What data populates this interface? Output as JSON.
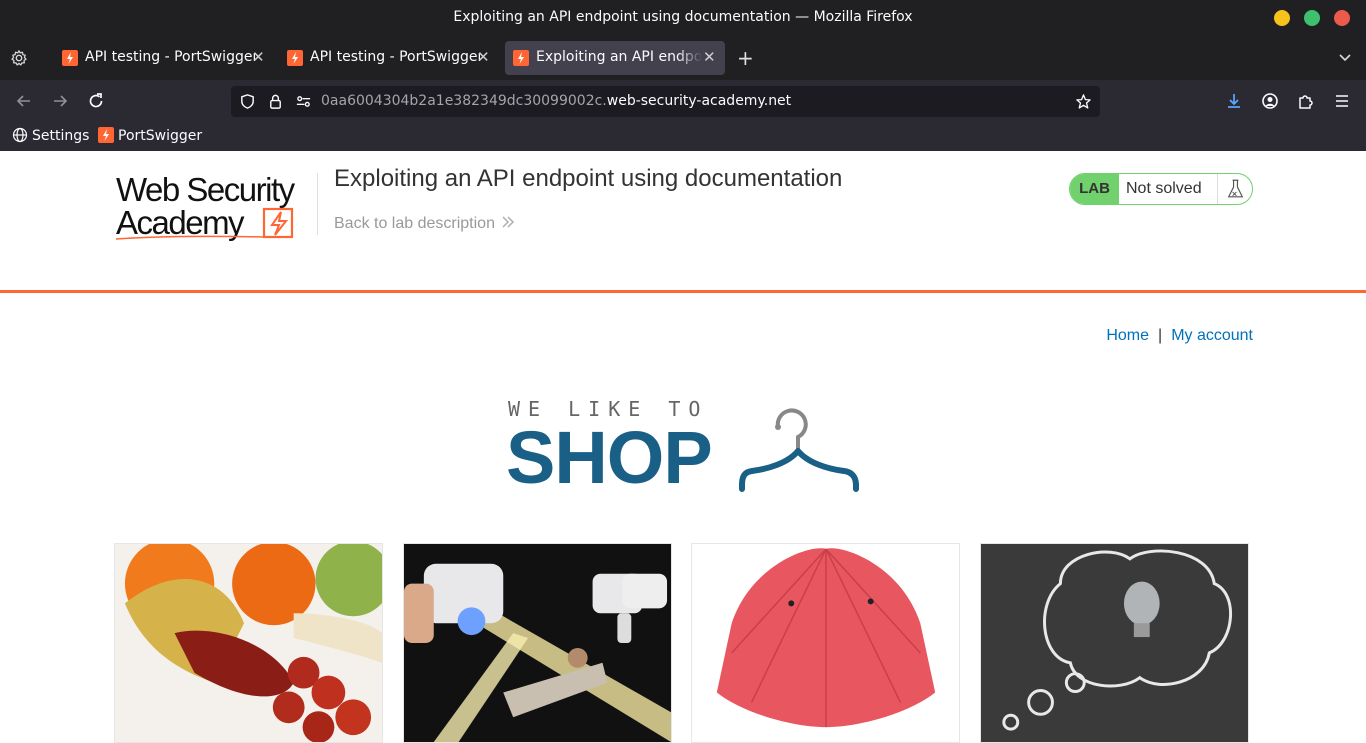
{
  "window": {
    "title": "Exploiting an API endpoint using documentation — Mozilla Firefox"
  },
  "tabs": [
    {
      "label": "API testing - PortSwigger"
    },
    {
      "label": "API testing - PortSwigger"
    },
    {
      "label": "Exploiting an API endpoint using documentation"
    }
  ],
  "url": {
    "prefix": "0aa6004304b2a1e382349dc30099002c.",
    "domain": "web-security-academy.net"
  },
  "bookmarks": [
    {
      "label": "Settings"
    },
    {
      "label": "PortSwigger"
    }
  ],
  "lab": {
    "logo_text": "Web Security Academy",
    "title": "Exploiting an API endpoint using documentation",
    "back_link": "Back to lab description",
    "badge": "LAB",
    "status": "Not solved"
  },
  "nav": {
    "home": "Home",
    "separator": "|",
    "account": "My account"
  },
  "banner": {
    "small": "WE LIKE TO",
    "big": "SHOP"
  },
  "colors": {
    "accent_orange": "#ff6633",
    "link_blue": "#0071bc",
    "status_green": "#70d16d",
    "shop_blue": "#1a5f85"
  },
  "products": [
    {
      "image": "banana-sausage-photo"
    },
    {
      "image": "laser-tag-guns-photo"
    },
    {
      "image": "red-umbrella-photo"
    },
    {
      "image": "lightbulb-chalkboard-photo"
    }
  ]
}
